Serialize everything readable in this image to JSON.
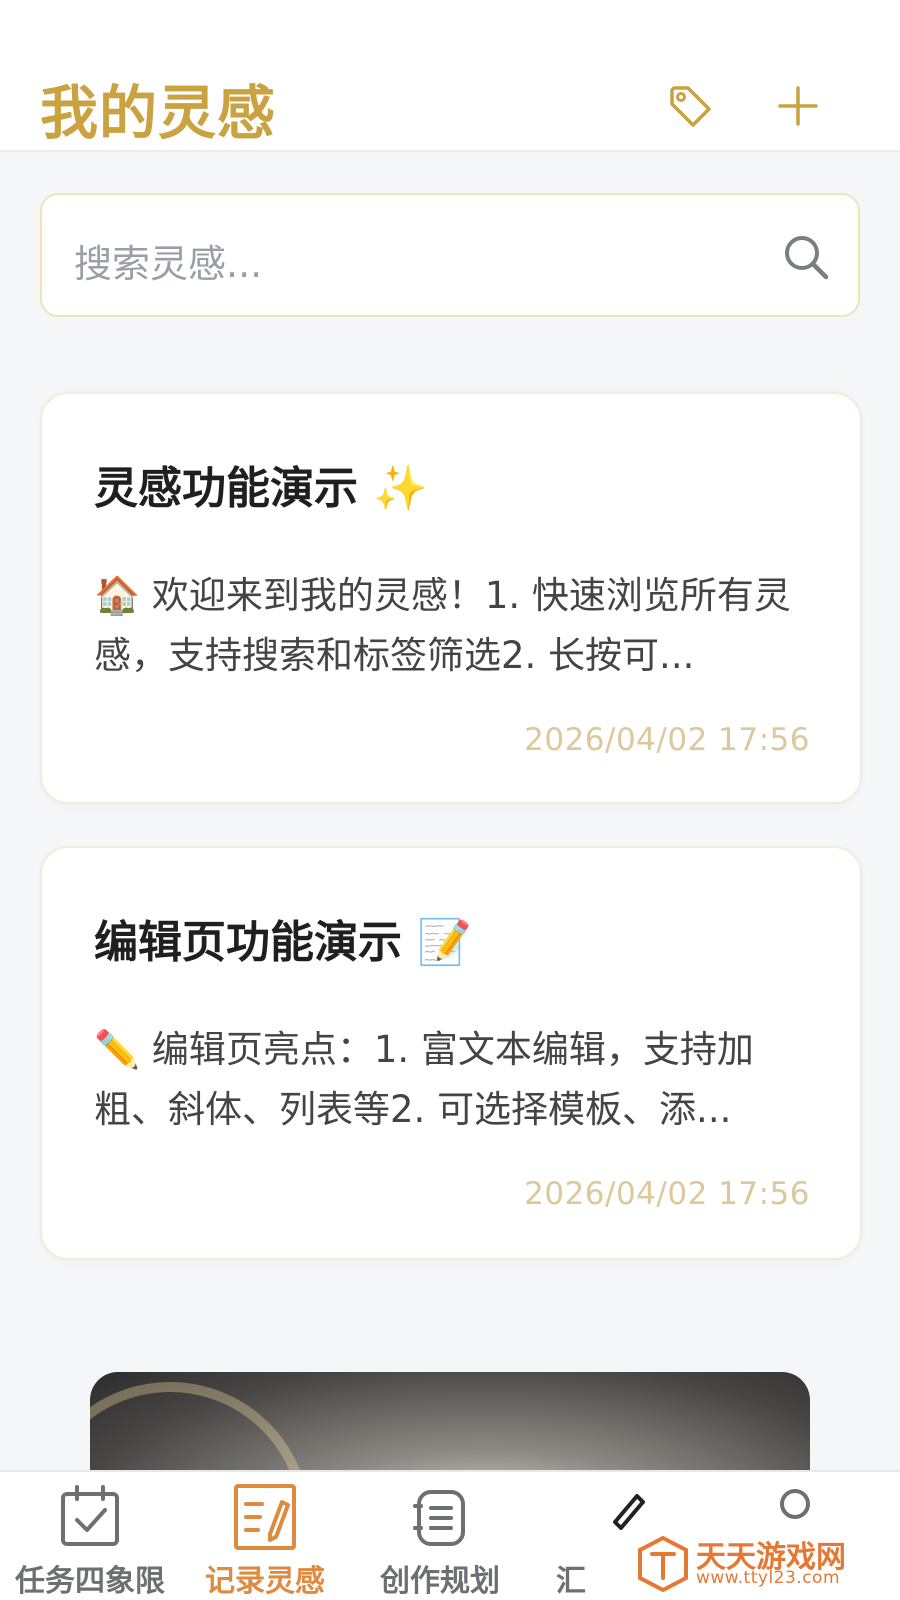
{
  "header": {
    "title": "我的灵感",
    "tag_icon": "tag-icon",
    "add_icon": "plus-icon"
  },
  "search": {
    "placeholder": "搜索灵感...",
    "icon": "search-icon"
  },
  "notes": [
    {
      "title": "灵感功能演示 ✨",
      "preview": "🏠 欢迎来到我的灵感！1. 快速浏览所有灵感，支持搜索和标签筛选2. 长按可...",
      "date": "2026/04/02 17:56"
    },
    {
      "title": "编辑页功能演示 📝",
      "preview": "✏️ 编辑页亮点：1. 富文本编辑，支持加粗、斜体、列表等2. 可选择模板、添...",
      "date": "2026/04/02 17:56"
    }
  ],
  "tabs": [
    {
      "label": "任务四象限",
      "icon": "calendar-check-icon",
      "active": false
    },
    {
      "label": "记录灵感",
      "icon": "note-pen-icon",
      "active": true
    },
    {
      "label": "创作规划",
      "icon": "list-notebook-icon",
      "active": false
    },
    {
      "label": "汇",
      "icon": "pen-icon",
      "active": false
    },
    {
      "label": "",
      "icon": "profile-icon",
      "active": false
    }
  ],
  "watermark": {
    "title": "天天游戏网",
    "url": "www.ttyl23.com"
  },
  "colors": {
    "accent_gold": "#caa23f",
    "active_tab": "#df8a3e",
    "date_text": "#dcc89a",
    "background": "#f5f6f8"
  }
}
